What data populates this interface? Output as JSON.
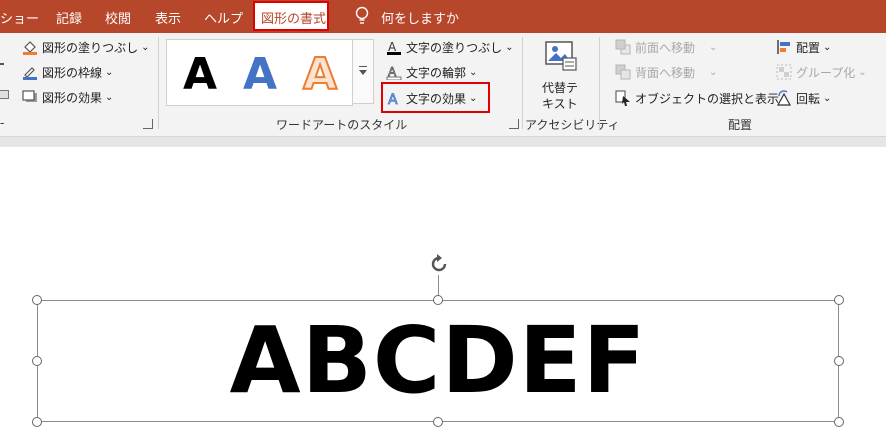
{
  "tabs": [
    {
      "label": "ショー"
    },
    {
      "label": "記録"
    },
    {
      "label": "校閲"
    },
    {
      "label": "表示"
    },
    {
      "label": "ヘルプ"
    }
  ],
  "active_tab": {
    "label": "図形の書式"
  },
  "tell_me": {
    "label": "何をしますか"
  },
  "colors": {
    "tab_bar": "#b7472a",
    "highlight": "#e00000",
    "wordart_blue": "#4472c4",
    "wordart_orange": "#ed7d31"
  },
  "ribbon": {
    "shape_styles": {
      "fill": "図形の塗りつぶし",
      "outline": "図形の枠線",
      "effects": "図形の効果"
    },
    "wordart_styles": {
      "samples": [
        "A",
        "A",
        "A"
      ],
      "text_fill": "文字の塗りつぶし",
      "text_outline": "文字の輪郭",
      "text_effects": "文字の効果",
      "group_label": "ワードアートのスタイル"
    },
    "accessibility": {
      "alt_text_line1": "代替テ",
      "alt_text_line2": "キスト",
      "group_label": "アクセシビリティ"
    },
    "arrange": {
      "bring_forward": "前面へ移動",
      "send_backward": "背面へ移動",
      "selection_pane": "オブジェクトの選択と表示",
      "align": "配置",
      "group": "グループ化",
      "rotate": "回転",
      "group_label": "配置"
    }
  },
  "slide": {
    "text": "ABCDEF"
  }
}
